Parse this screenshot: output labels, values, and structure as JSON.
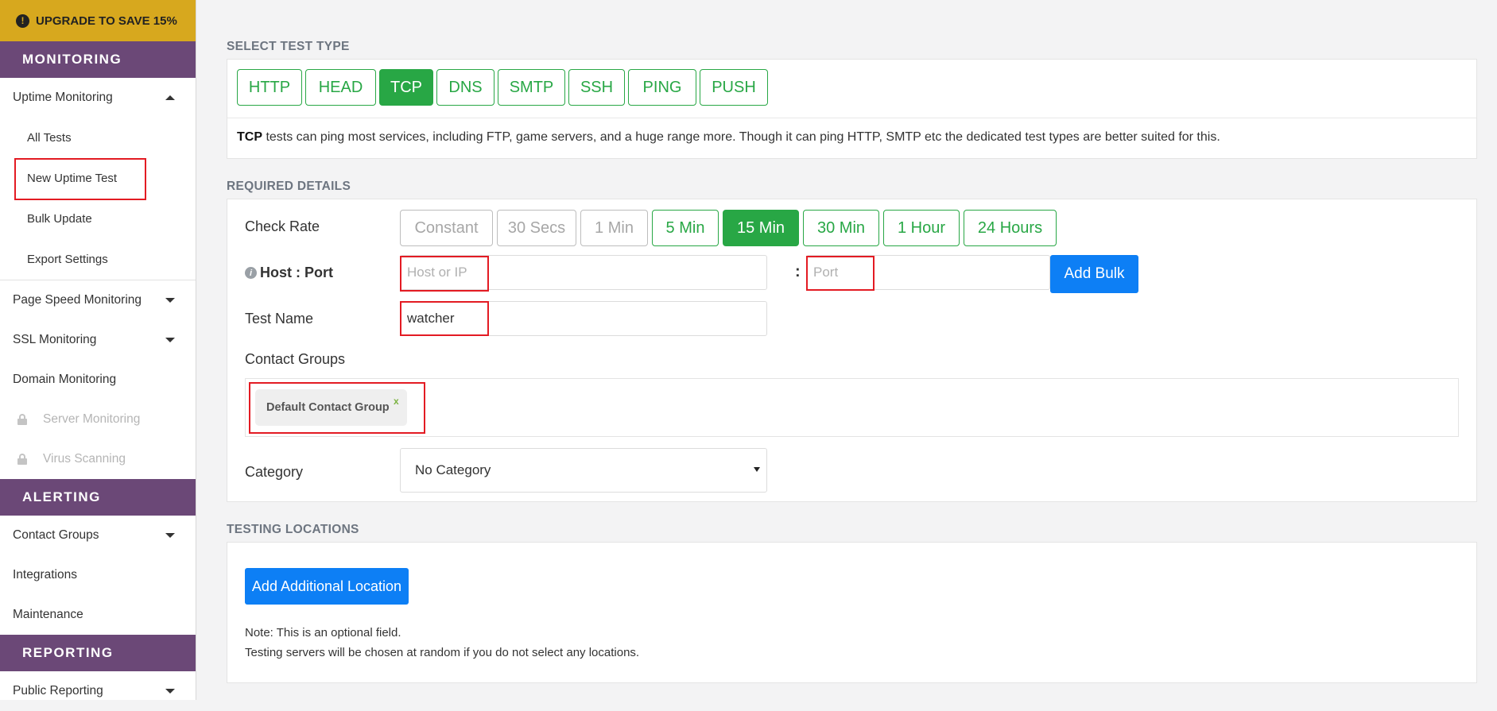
{
  "sidebar": {
    "upgrade_label": "UPGRADE TO SAVE 15%",
    "sections": {
      "monitoring": "MONITORING",
      "alerting": "ALERTING",
      "reporting": "REPORTING"
    },
    "uptime_monitoring": "Uptime Monitoring",
    "uptime_subitems": [
      "All Tests",
      "New Uptime Test",
      "Bulk Update",
      "Export Settings"
    ],
    "page_speed": "Page Speed Monitoring",
    "ssl": "SSL Monitoring",
    "domain": "Domain Monitoring",
    "server": "Server Monitoring",
    "virus": "Virus Scanning",
    "contact_groups": "Contact Groups",
    "integrations": "Integrations",
    "maintenance": "Maintenance",
    "public_reporting": "Public Reporting"
  },
  "test_type": {
    "title": "SELECT TEST TYPE",
    "types": [
      "HTTP",
      "HEAD",
      "TCP",
      "DNS",
      "SMTP",
      "SSH",
      "PING",
      "PUSH"
    ],
    "selected": "TCP",
    "desc_bold": "TCP",
    "desc_text": " tests can ping most services, including FTP, game servers, and a huge range more. Though it can ping HTTP, SMTP etc the dedicated test types are better suited for this."
  },
  "required": {
    "title": "REQUIRED DETAILS",
    "check_rate_label": "Check Rate",
    "rates": [
      "Constant",
      "30 Secs",
      "1 Min",
      "5 Min",
      "15 Min",
      "30 Min",
      "1 Hour",
      "24 Hours"
    ],
    "selected_rate": "15 Min",
    "host_port_label": "Host : Port",
    "host_placeholder": "Host or IP",
    "port_separator": ":",
    "port_placeholder": "Port",
    "add_bulk": "Add Bulk",
    "test_name_label": "Test Name",
    "test_name_value": "watcher",
    "contact_groups_label": "Contact Groups",
    "contact_tag": "Default Contact Group",
    "contact_tag_remove": "x",
    "category_label": "Category",
    "category_value": "No Category"
  },
  "locations": {
    "title": "TESTING LOCATIONS",
    "add_button": "Add Additional Location",
    "note1": "Note: This is an optional field.",
    "note2": "Testing servers will be chosen at random if you do not select any locations."
  },
  "colors": {
    "brand_purple": "#6b4877",
    "upgrade_gold": "#d7a81e",
    "success_green": "#28a745",
    "primary_blue": "#0d7ff5",
    "highlight_red": "#e31b23"
  }
}
